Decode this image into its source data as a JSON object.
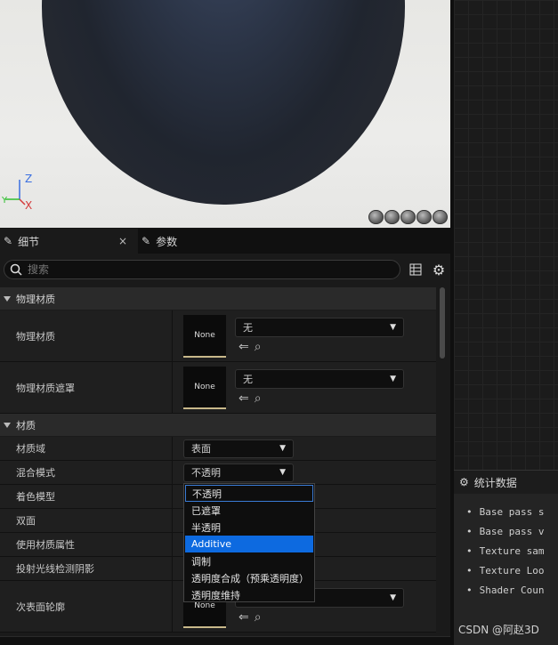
{
  "viewport": {
    "axis_z": "Z",
    "axis_x": "X",
    "axis_y": "Y",
    "preview_shapes": [
      "cylinder-icon",
      "sphere-icon",
      "plane-icon",
      "cube-icon",
      "custom-mesh-icon"
    ]
  },
  "details": {
    "tabs": [
      {
        "label": "细节",
        "icon": "pencil-icon",
        "active": true,
        "close": "×"
      },
      {
        "label": "参数",
        "icon": "pencil-icon",
        "active": false
      }
    ],
    "search_placeholder": "搜索",
    "categories": {
      "physical": {
        "label": "物理材质",
        "rows": [
          {
            "name": "物理材质",
            "thumb": "None",
            "combo": "无"
          },
          {
            "name": "物理材质遮罩",
            "thumb": "None",
            "combo": "无"
          }
        ]
      },
      "material": {
        "label": "材质",
        "rows": [
          {
            "name": "材质域",
            "value": "表面"
          },
          {
            "name": "混合模式",
            "value": "不透明"
          },
          {
            "name": "着色模型"
          },
          {
            "name": "双面"
          },
          {
            "name": "使用材质属性"
          },
          {
            "name": "投射光线检测阴影"
          },
          {
            "name": "次表面轮廓",
            "thumb": "None"
          }
        ]
      }
    },
    "dropdown_options": [
      "不透明",
      "已遮罩",
      "半透明",
      "Additive",
      "调制",
      "透明度合成（预乘透明度）",
      "透明度维持"
    ]
  },
  "stats": {
    "title": "统计数据",
    "items": [
      "Base pass s",
      "Base pass v",
      "Texture sam",
      "Texture Loo",
      "Shader Coun"
    ]
  },
  "watermark": "CSDN @阿赵3D"
}
